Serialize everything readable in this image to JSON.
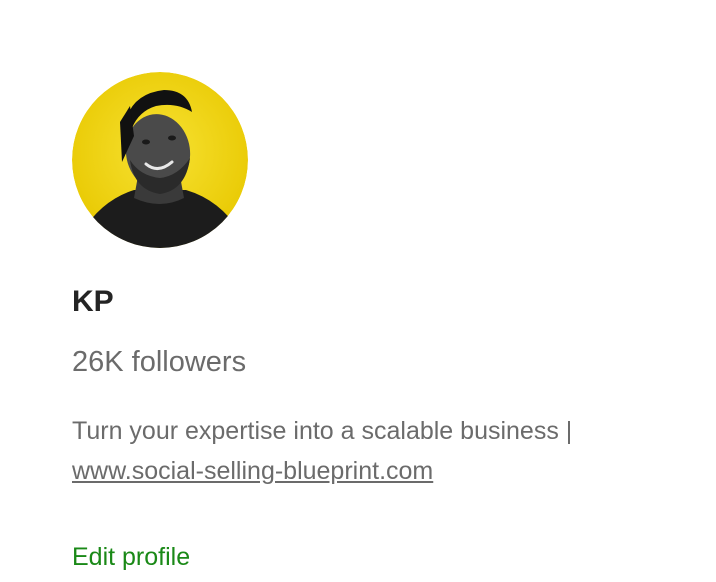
{
  "profile": {
    "name": "KP",
    "followers": "26K followers",
    "bio_text": "Turn your expertise into a scalable business |",
    "bio_link": "www.social-selling-blueprint.com",
    "edit_profile_label": "Edit profile",
    "avatar_icon": "profile-photo",
    "colors": {
      "avatar_background": "#f2d600",
      "edit_link": "#1a8917",
      "name": "#242424",
      "secondary_text": "#6b6b6b"
    }
  }
}
